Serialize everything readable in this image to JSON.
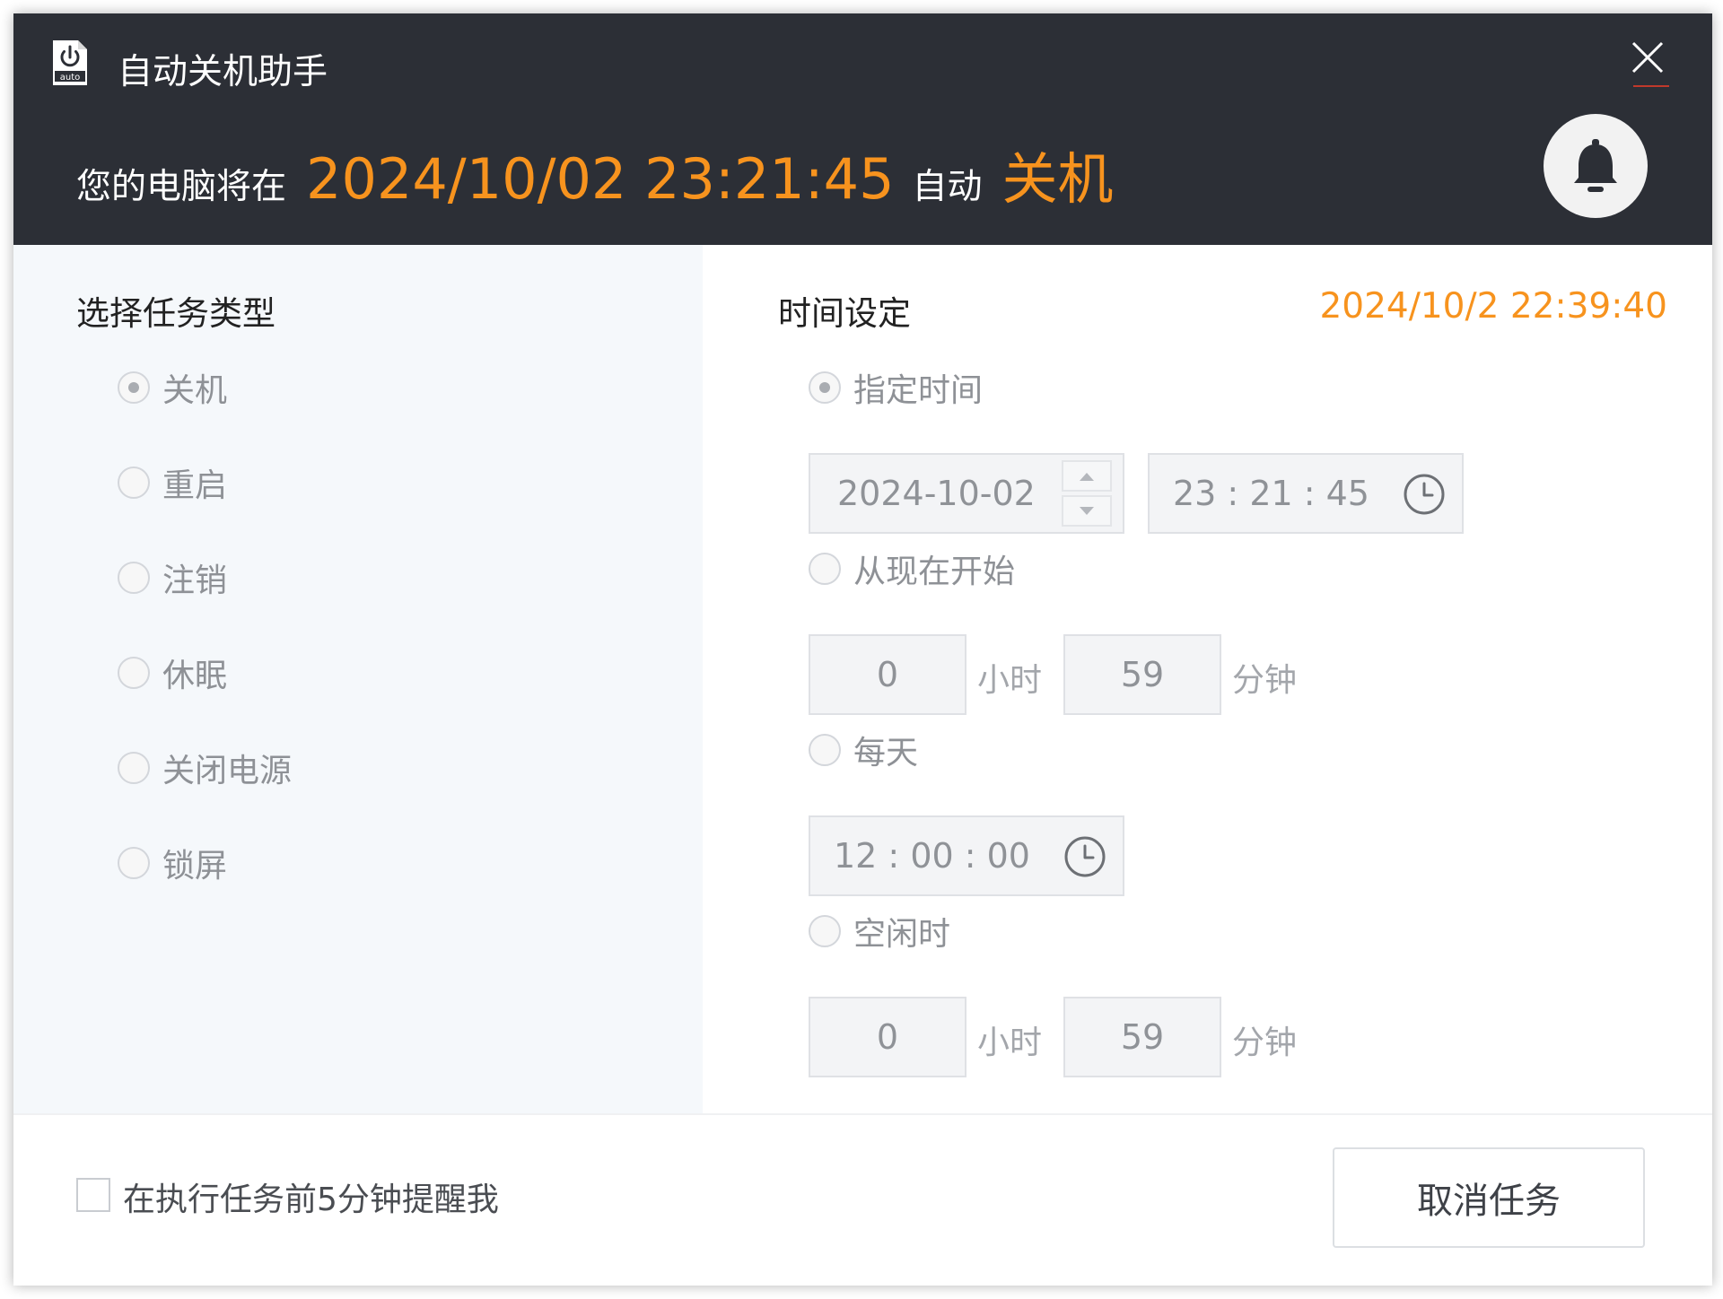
{
  "window": {
    "title": "自动关机助手",
    "icon": "power-auto-icon",
    "close_icon": "close-icon"
  },
  "header": {
    "prefix": "您的电脑将在",
    "target_time": "2024/10/02 23:21:45",
    "middle": "自动",
    "action": "关机",
    "bell_icon": "bell-icon"
  },
  "task_type": {
    "title": "选择任务类型",
    "options": [
      {
        "label": "关机",
        "checked": true
      },
      {
        "label": "重启",
        "checked": false
      },
      {
        "label": "注销",
        "checked": false
      },
      {
        "label": "休眠",
        "checked": false
      },
      {
        "label": "关闭电源",
        "checked": false
      },
      {
        "label": "锁屏",
        "checked": false
      }
    ]
  },
  "time_settings": {
    "title": "时间设定",
    "current_time": "2024/10/2 22:39:40",
    "specified": {
      "label": "指定时间",
      "checked": true,
      "date": "2024-10-02",
      "time": "23 : 21 : 45"
    },
    "from_now": {
      "label": "从现在开始",
      "checked": false,
      "hours": "0",
      "hours_unit": "小时",
      "minutes": "59",
      "minutes_unit": "分钟"
    },
    "daily": {
      "label": "每天",
      "checked": false,
      "time": "12 : 00 : 00"
    },
    "idle": {
      "label": "空闲时",
      "checked": false,
      "hours": "0",
      "hours_unit": "小时",
      "minutes": "59",
      "minutes_unit": "分钟"
    }
  },
  "footer": {
    "reminder_label": "在执行任务前5分钟提醒我",
    "reminder_checked": false,
    "cancel_button": "取消任务"
  },
  "colors": {
    "header_bg": "#2c2f36",
    "accent_orange": "#f7931e",
    "left_panel_bg": "#f5f8fb"
  }
}
